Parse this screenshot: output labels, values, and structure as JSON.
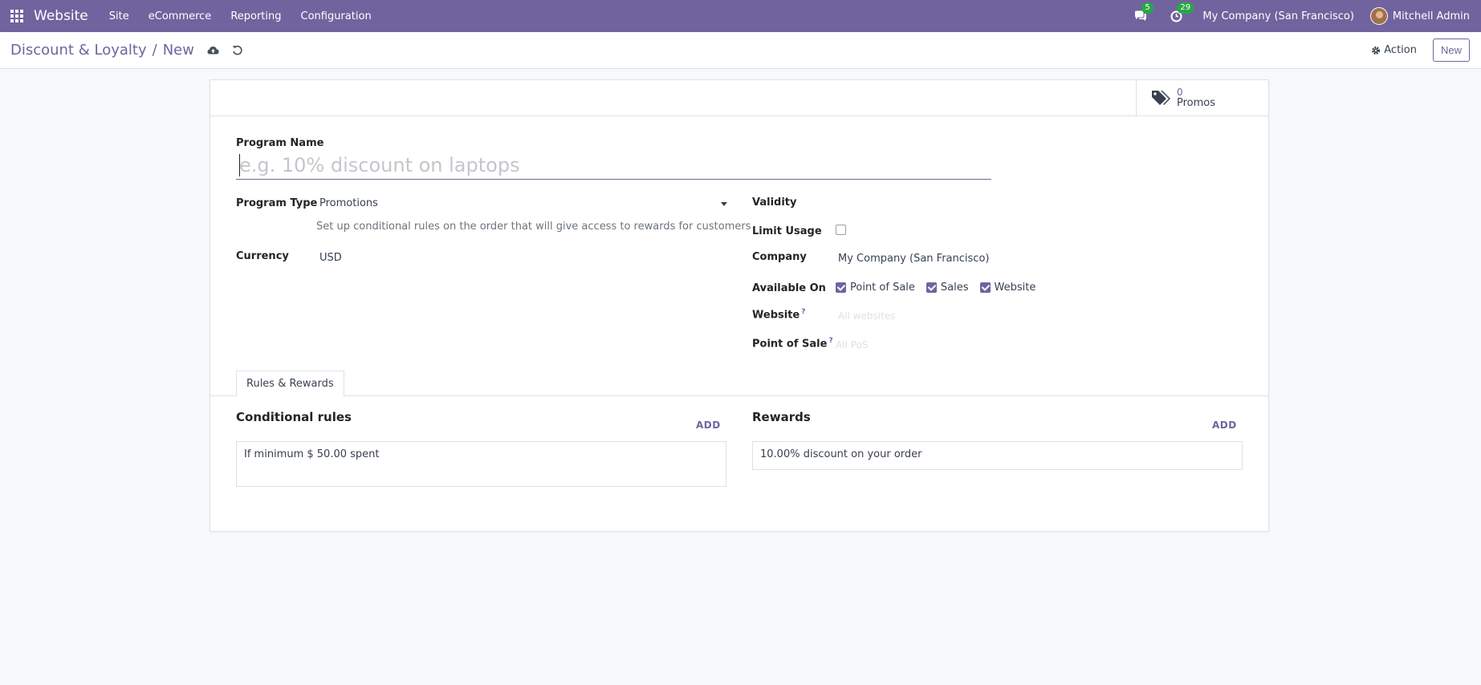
{
  "navbar": {
    "app_name": "Website",
    "menu": [
      "Site",
      "eCommerce",
      "Reporting",
      "Configuration"
    ],
    "messages_count": "5",
    "activities_count": "29",
    "company": "My Company (San Francisco)",
    "user": "Mitchell Admin",
    "bg_color": "#71639e"
  },
  "control": {
    "breadcrumb_parent": "Discount & Loyalty",
    "breadcrumb_sep": "/",
    "breadcrumb_current": "New",
    "action_label": "Action",
    "new_label": "New"
  },
  "smart_button": {
    "value": "0",
    "label": "Promos",
    "icon": "tags-icon"
  },
  "form": {
    "program_name_label": "Program Name",
    "program_name_placeholder": "e.g. 10% discount on laptops",
    "program_type_label": "Program Type",
    "program_type_value": "Promotions",
    "program_type_help": "Set up conditional rules on the order that will give access to rewards for customers",
    "currency_label": "Currency",
    "currency_value": "USD",
    "validity_label": "Validity",
    "limit_usage_label": "Limit Usage",
    "limit_usage_checked": false,
    "company_label": "Company",
    "company_value": "My Company (San Francisco)",
    "available_on_label": "Available On",
    "available_on": [
      {
        "label": "Point of Sale",
        "checked": true
      },
      {
        "label": "Sales",
        "checked": true
      },
      {
        "label": "Website",
        "checked": true
      }
    ],
    "website_label": "Website",
    "website_help": "?",
    "website_placeholder": "All websites",
    "pos_label": "Point of Sale",
    "pos_help": "?",
    "pos_placeholder": "All PoS"
  },
  "tabs": {
    "rules_rewards": "Rules & Rewards"
  },
  "rules": {
    "title": "Conditional rules",
    "add": "ADD",
    "items": [
      "If minimum $ 50.00 spent"
    ]
  },
  "rewards": {
    "title": "Rewards",
    "add": "ADD",
    "items": [
      "10.00% discount on your order"
    ]
  }
}
